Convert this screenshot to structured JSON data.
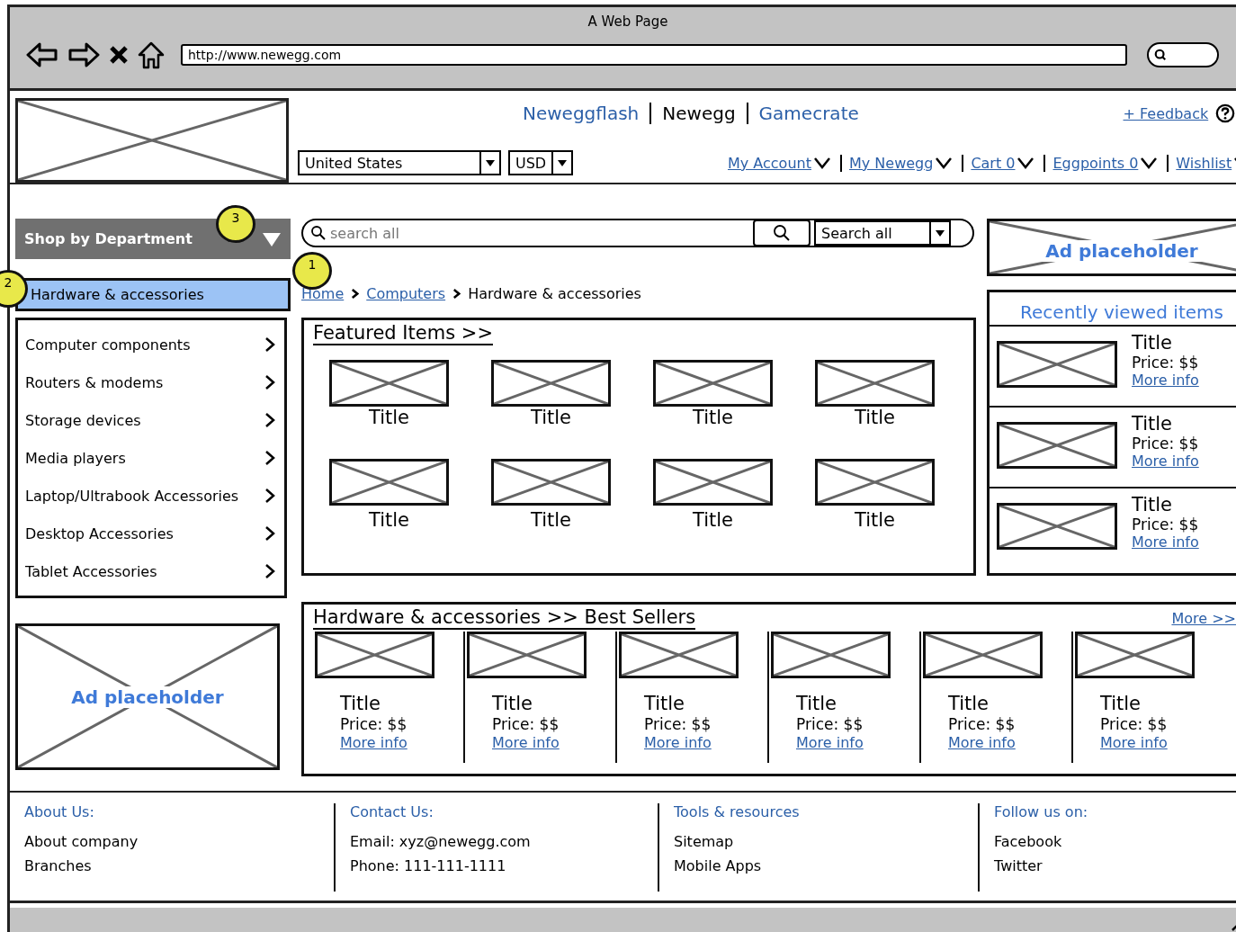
{
  "window": {
    "title": "A Web Page",
    "url": "http://www.newegg.com"
  },
  "header": {
    "sites": [
      {
        "label": "Neweggflash",
        "selected": false
      },
      {
        "label": "Newegg",
        "selected": true
      },
      {
        "label": "Gamecrate",
        "selected": false
      }
    ],
    "feedback": "+ Feedback",
    "country": "United States",
    "currency": "USD",
    "account_links": [
      "My Account",
      "My Newegg",
      "Cart 0",
      "Eggpoints 0",
      "Wishlist"
    ]
  },
  "department_menu": {
    "label": "Shop by Department"
  },
  "current_category": {
    "label": "Hardware & accessories"
  },
  "subcategories": [
    "Computer components",
    "Routers & modems",
    "Storage devices",
    "Media players",
    "Laptop/Ultrabook Accessories",
    "Desktop Accessories",
    "Tablet Accessories"
  ],
  "left_ad": {
    "label": "Ad placeholder"
  },
  "search": {
    "placeholder": "search all",
    "scope": "Search all"
  },
  "breadcrumb": [
    {
      "label": "Home",
      "kind": "link"
    },
    {
      "label": "Computers",
      "kind": "link"
    },
    {
      "label": "Hardware & accessories",
      "kind": "current"
    }
  ],
  "featured": {
    "title": "Featured Items >>",
    "items": [
      "Title",
      "Title",
      "Title",
      "Title",
      "Title",
      "Title",
      "Title",
      "Title"
    ]
  },
  "right_ad": {
    "label": "Ad placeholder"
  },
  "recently_viewed": {
    "title": "Recently viewed items",
    "items": [
      {
        "title": "Title",
        "price": "Price: $$",
        "link": "More info"
      },
      {
        "title": "Title",
        "price": "Price: $$",
        "link": "More info"
      },
      {
        "title": "Title",
        "price": "Price: $$",
        "link": "More info"
      }
    ]
  },
  "best_sellers": {
    "title": "Hardware & accessories >> Best Sellers",
    "more": "More >>",
    "items": [
      {
        "title": "Title",
        "price": "Price: $$",
        "link": "More info"
      },
      {
        "title": "Title",
        "price": "Price: $$",
        "link": "More info"
      },
      {
        "title": "Title",
        "price": "Price: $$",
        "link": "More info"
      },
      {
        "title": "Title",
        "price": "Price: $$",
        "link": "More info"
      },
      {
        "title": "Title",
        "price": "Price: $$",
        "link": "More info"
      },
      {
        "title": "Title",
        "price": "Price: $$",
        "link": "More info"
      }
    ]
  },
  "footer": {
    "columns": [
      {
        "heading": "About Us:",
        "lines": [
          "About company",
          "Branches"
        ]
      },
      {
        "heading": "Contact Us:",
        "lines": [
          "Email: xyz@newegg.com",
          "Phone: 111-111-1111"
        ]
      },
      {
        "heading": "Tools & resources",
        "lines": [
          "Sitemap",
          "Mobile Apps"
        ]
      },
      {
        "heading": "Follow us on:",
        "lines": [
          "Facebook",
          "Twitter"
        ]
      }
    ]
  },
  "annotations": [
    {
      "label": "3"
    },
    {
      "label": "1"
    },
    {
      "label": "2"
    }
  ]
}
